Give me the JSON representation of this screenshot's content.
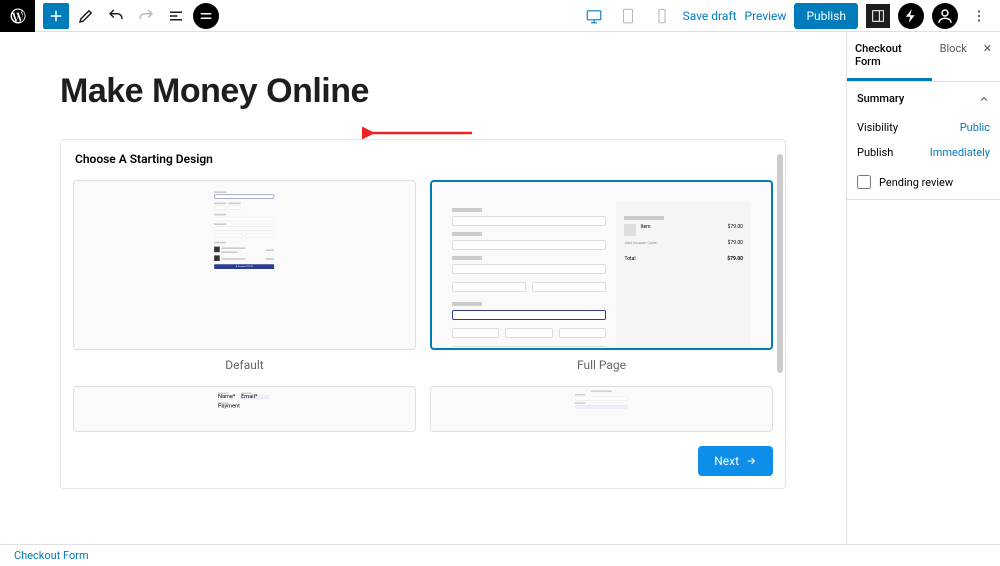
{
  "toolbar": {
    "save_draft": "Save draft",
    "preview": "Preview",
    "publish": "Publish"
  },
  "page": {
    "title": "Make Money Online"
  },
  "design_panel": {
    "heading": "Choose A Starting Design",
    "options": [
      {
        "label": "Default",
        "selected": false
      },
      {
        "label": "Full Page",
        "selected": true
      }
    ],
    "next": "Next"
  },
  "sidebar": {
    "tabs": {
      "primary": "Checkout Form",
      "secondary": "Block"
    },
    "summary": {
      "heading": "Summary",
      "visibility_label": "Visibility",
      "visibility_value": "Public",
      "publish_label": "Publish",
      "publish_value": "Immediately",
      "pending_review": "Pending review"
    }
  },
  "breadcrumb": "Checkout Form"
}
